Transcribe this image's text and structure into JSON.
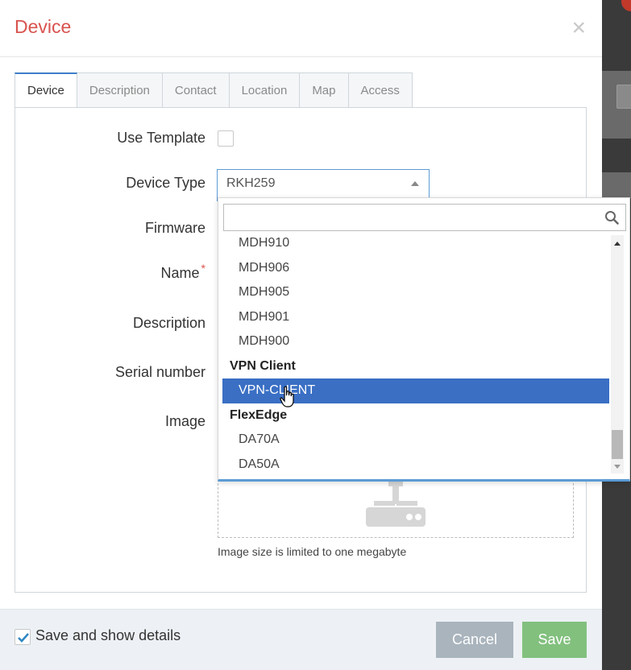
{
  "modal": {
    "title": "Device",
    "close_glyph": "×"
  },
  "tabs": [
    "Device",
    "Description",
    "Contact",
    "Location",
    "Map",
    "Access"
  ],
  "active_tab": "Device",
  "form": {
    "use_template_label": "Use Template",
    "device_type_label": "Device Type",
    "firmware_label": "Firmware",
    "name_label": "Name",
    "name_required_marker": "*",
    "description_label": "Description",
    "serial_number_label": "Serial number",
    "image_label": "Image",
    "device_type_value": "RKH259",
    "image_hint": "Image size is limited to one megabyte"
  },
  "dropdown": {
    "search_value": "",
    "items": [
      {
        "label": "MDH910",
        "kind": "option"
      },
      {
        "label": "MDH906",
        "kind": "option"
      },
      {
        "label": "MDH905",
        "kind": "option"
      },
      {
        "label": "MDH901",
        "kind": "option"
      },
      {
        "label": "MDH900",
        "kind": "option"
      },
      {
        "label": "VPN Client",
        "kind": "group"
      },
      {
        "label": "VPN-CLIENT",
        "kind": "option",
        "highlighted": true
      },
      {
        "label": "FlexEdge",
        "kind": "group"
      },
      {
        "label": "DA70A",
        "kind": "option"
      },
      {
        "label": "DA50A",
        "kind": "option"
      }
    ]
  },
  "footer": {
    "save_show_details_label": "Save and show details",
    "save_show_details_checked": true,
    "cancel_label": "Cancel",
    "save_label": "Save"
  },
  "colors": {
    "title": "#d9534f",
    "active_tab_border": "#3d7ec6",
    "highlight": "#3a6fc4",
    "cancel_button": "#a9b4bd",
    "save_button": "#82c07e"
  }
}
